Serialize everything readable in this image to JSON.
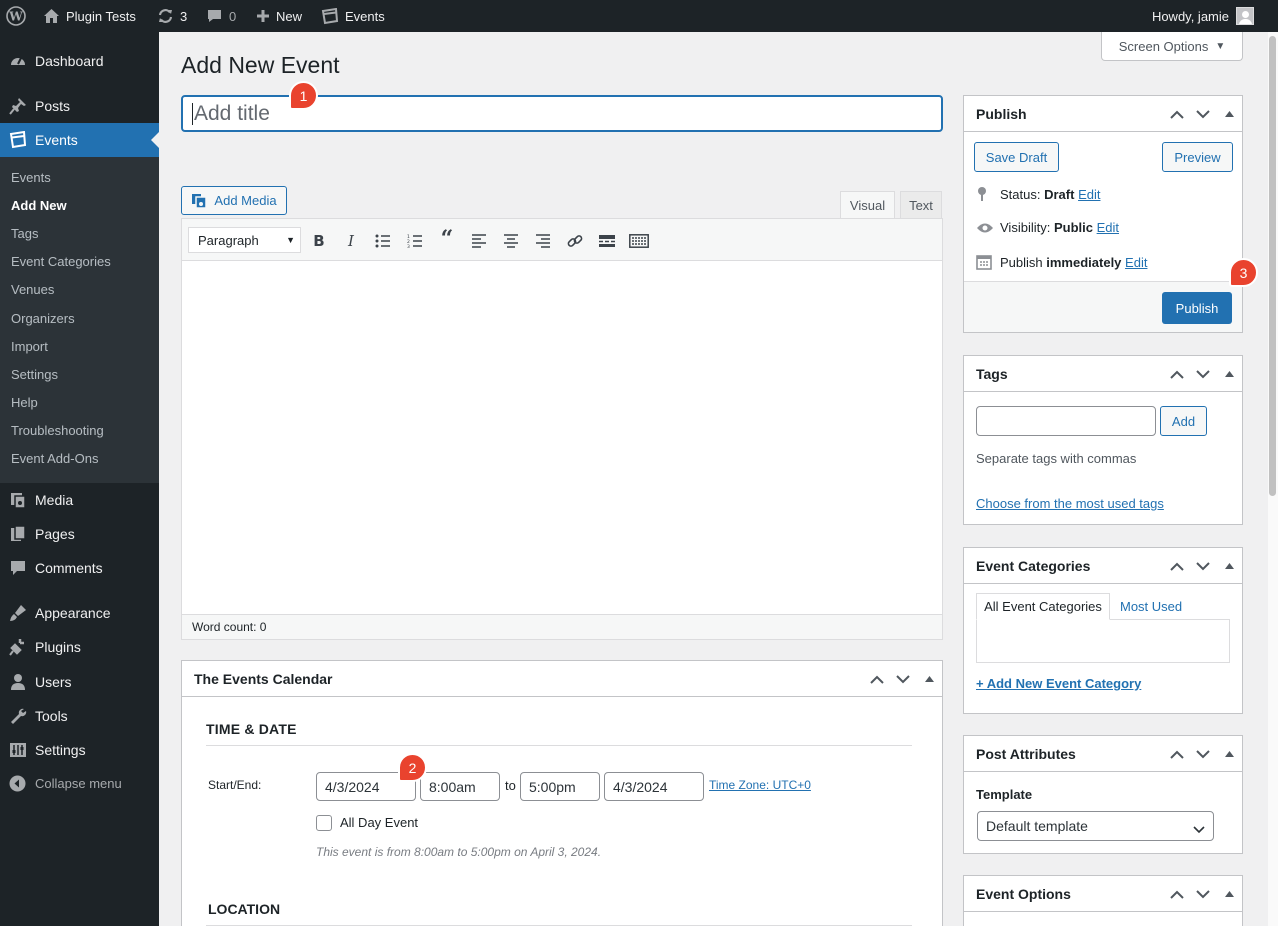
{
  "admin_bar": {
    "site_name": "Plugin Tests",
    "updates_count": "3",
    "comments_count": "0",
    "new_label": "New",
    "events_label": "Events",
    "greeting": "Howdy, jamie"
  },
  "sidebar": {
    "top_items": [
      {
        "label": "Dashboard",
        "icon": "dashboard-icon"
      },
      {
        "label": "Posts",
        "icon": "pin-icon"
      },
      {
        "label": "Events",
        "icon": "calendar-icon"
      },
      {
        "label": "Media",
        "icon": "media-icon"
      },
      {
        "label": "Pages",
        "icon": "pages-icon"
      },
      {
        "label": "Comments",
        "icon": "comment-icon"
      },
      {
        "label": "Appearance",
        "icon": "brush-icon"
      },
      {
        "label": "Plugins",
        "icon": "plug-icon"
      },
      {
        "label": "Users",
        "icon": "user-icon"
      },
      {
        "label": "Tools",
        "icon": "wrench-icon"
      },
      {
        "label": "Settings",
        "icon": "sliders-icon"
      }
    ],
    "submenu": [
      "Events",
      "Add New",
      "Tags",
      "Event Categories",
      "Venues",
      "Organizers",
      "Import",
      "Settings",
      "Help",
      "Troubleshooting",
      "Event Add-Ons"
    ],
    "collapse_label": "Collapse menu"
  },
  "page": {
    "title": "Add New Event",
    "screen_options": "Screen Options",
    "title_placeholder": "Add title"
  },
  "badges": {
    "one": "1",
    "two": "2",
    "three": "3"
  },
  "editor": {
    "add_media": "Add Media",
    "tab_visual": "Visual",
    "tab_text": "Text",
    "format_select": "Paragraph",
    "word_count": "Word count: 0"
  },
  "events_calendar": {
    "heading": "The Events Calendar",
    "section_time": "TIME & DATE",
    "start_end_label": "Start/End:",
    "start_date": "4/3/2024",
    "start_time": "8:00am",
    "to_label": "to",
    "end_time": "5:00pm",
    "end_date": "4/3/2024",
    "timezone_link": "Time Zone: UTC+0",
    "all_day_label": "All Day Event",
    "summary": "This event is from 8:00am to 5:00pm on April 3, 2024.",
    "section_location": "LOCATION"
  },
  "publish": {
    "heading": "Publish",
    "save_draft": "Save Draft",
    "preview": "Preview",
    "status_label": "Status:",
    "status_value": "Draft",
    "visibility_label": "Visibility:",
    "visibility_value": "Public",
    "publish_label": "Publish",
    "publish_value": "immediately",
    "edit": "Edit",
    "publish_button": "Publish"
  },
  "tags": {
    "heading": "Tags",
    "add_button": "Add",
    "hint": "Separate tags with commas",
    "most_used_link": "Choose from the most used tags"
  },
  "event_categories": {
    "heading": "Event Categories",
    "tab_all": "All Event Categories",
    "tab_most_used": "Most Used",
    "add_new_link": "+ Add New Event Category"
  },
  "post_attributes": {
    "heading": "Post Attributes",
    "template_label": "Template",
    "template_value": "Default template"
  },
  "event_options": {
    "heading": "Event Options"
  }
}
